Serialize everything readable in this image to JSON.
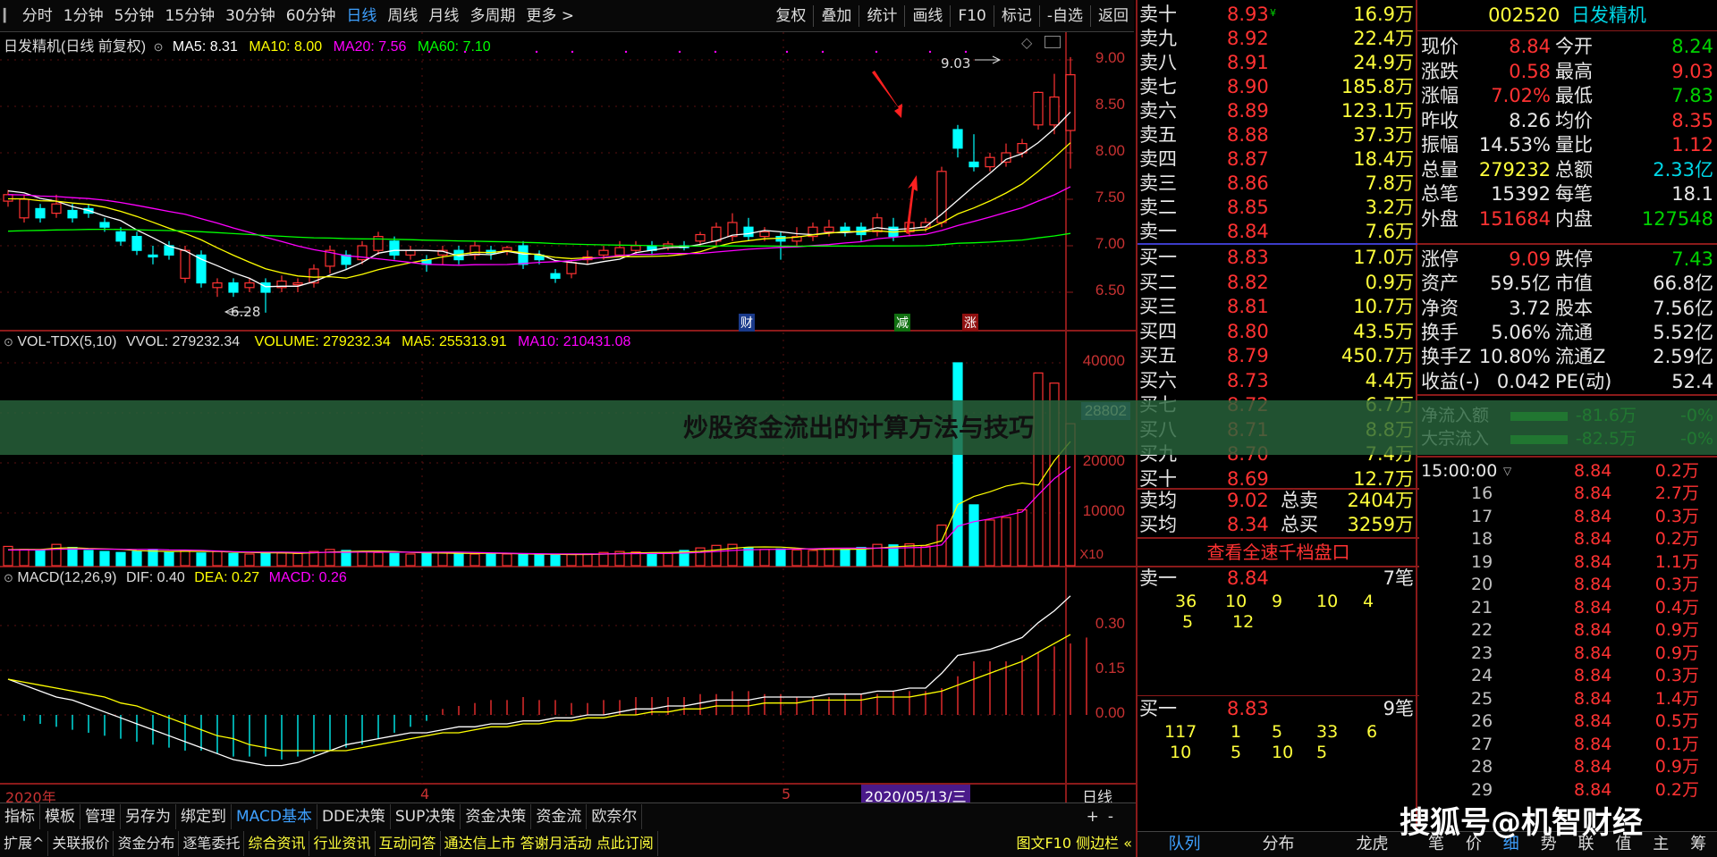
{
  "toolbar": {
    "periods": [
      "分时",
      "1分钟",
      "5分钟",
      "15分钟",
      "30分钟",
      "60分钟",
      "日线",
      "周线",
      "月线",
      "多周期",
      "更多 >"
    ],
    "actions": [
      "复权",
      "叠加",
      "统计",
      "画线",
      "F10",
      "标记",
      "-自选",
      "返回"
    ]
  },
  "kline": {
    "title": "日发精机(日线 前复权)",
    "ma5": "MA5: 8.31",
    "ma10": "MA10: 8.00",
    "ma20": "MA20: 7.56",
    "ma60": "MA60: 7.10",
    "high_label": "9.03",
    "low_label": "6.28",
    "markers": [
      "财",
      "减",
      "涨"
    ],
    "price_axis": [
      "9.00",
      "8.50",
      "8.00",
      "7.50",
      "7.00",
      "6.50"
    ],
    "colors": {
      "up": "#ff3232",
      "down": "#00ffff",
      "ma5": "#ffffff",
      "ma10": "#ffff00",
      "ma20": "#ff00ff",
      "ma60": "#00ff00"
    }
  },
  "volume": {
    "title": "VOL-TDX(5,10)",
    "vvol": "VVOL: 279232.34",
    "volume": "VOLUME: 279232.34",
    "ma5": "MA5: 255313.91",
    "ma10": "MA10: 210431.08",
    "axis": [
      "40000",
      "30000",
      "20000",
      "10000"
    ],
    "crosshair_value": "28802",
    "unit": "X10"
  },
  "macd": {
    "title": "MACD(12,26,9)",
    "dif": "DIF: 0.40",
    "dea": "DEA: 0.27",
    "macd": "MACD: 0.26",
    "axis": [
      "0.30",
      "0.15",
      "0.00"
    ]
  },
  "time_axis": {
    "labels": [
      "2020年",
      "4",
      "5"
    ],
    "date_box": "2020/05/13/三",
    "period": "日线"
  },
  "bottom_tabs": [
    "指标",
    "模板",
    "管理",
    "另存为",
    "绑定到",
    "MACD基本",
    "DDE决策",
    "SUP决策",
    "资金决策",
    "资金流",
    "欧奈尔"
  ],
  "bottom_tabs_active": "MACD基本",
  "bottom_bar2": [
    "扩展^",
    "关联报价",
    "资金分布",
    "逐笔委托",
    "综合资讯",
    "行业资讯",
    "互动问答",
    "通达信上市 答谢月活动 点此订阅"
  ],
  "bottom_bar2_right": "图文F10 侧边栏 «",
  "zoom_buttons": [
    "+",
    "-"
  ],
  "order_book": {
    "sells": [
      {
        "label": "卖十",
        "price": "8.93",
        "vol": "16.9万"
      },
      {
        "label": "卖九",
        "price": "8.92",
        "vol": "22.4万"
      },
      {
        "label": "卖八",
        "price": "8.91",
        "vol": "24.9万"
      },
      {
        "label": "卖七",
        "price": "8.90",
        "vol": "185.8万"
      },
      {
        "label": "卖六",
        "price": "8.89",
        "vol": "123.1万"
      },
      {
        "label": "卖五",
        "price": "8.88",
        "vol": "37.3万"
      },
      {
        "label": "卖四",
        "price": "8.87",
        "vol": "18.4万"
      },
      {
        "label": "卖三",
        "price": "8.86",
        "vol": "7.8万"
      },
      {
        "label": "卖二",
        "price": "8.85",
        "vol": "3.2万"
      },
      {
        "label": "卖一",
        "price": "8.84",
        "vol": "7.6万"
      }
    ],
    "buys": [
      {
        "label": "买一",
        "price": "8.83",
        "vol": "17.0万"
      },
      {
        "label": "买二",
        "price": "8.82",
        "vol": "0.9万"
      },
      {
        "label": "买三",
        "price": "8.81",
        "vol": "10.7万"
      },
      {
        "label": "买四",
        "price": "8.80",
        "vol": "43.5万"
      },
      {
        "label": "买五",
        "price": "8.79",
        "vol": "450.7万"
      },
      {
        "label": "买六",
        "price": "8.73",
        "vol": "4.4万"
      },
      {
        "label": "买七",
        "price": "8.72",
        "vol": "6.7万"
      },
      {
        "label": "买八",
        "price": "8.71",
        "vol": "8.8万"
      },
      {
        "label": "买九",
        "price": "8.70",
        "vol": "7.4万"
      },
      {
        "label": "买十",
        "price": "8.69",
        "vol": "12.7万"
      }
    ],
    "sell_ten_flag": "¥",
    "avg_sell": {
      "label": "卖均",
      "price": "9.02",
      "tlabel": "总卖",
      "val": "2404万"
    },
    "avg_buy": {
      "label": "买均",
      "price": "8.34",
      "tlabel": "总买",
      "val": "3259万"
    },
    "view_button": "查看全速千档盘口",
    "queue_sell": {
      "label": "卖一",
      "price": "8.84",
      "count": "7笔",
      "row1": [
        "36",
        "10",
        "9",
        "10",
        "4"
      ],
      "row2": [
        "5",
        "12"
      ]
    },
    "queue_buy": {
      "label": "买一",
      "price": "8.83",
      "count": "9笔",
      "row1": [
        "117",
        "1",
        "5",
        "33",
        "6"
      ],
      "row2": [
        "10",
        "5",
        "10",
        "5"
      ]
    },
    "bottom_tabs": [
      "队列",
      "分布",
      "龙虎"
    ]
  },
  "info": {
    "code": "002520",
    "name": "日发精机",
    "rows": [
      {
        "l1": "现价",
        "v1": "8.84",
        "c1": "red",
        "l2": "今开",
        "v2": "8.24",
        "c2": "green"
      },
      {
        "l1": "涨跌",
        "v1": "0.58",
        "c1": "red",
        "l2": "最高",
        "v2": "9.03",
        "c2": "red"
      },
      {
        "l1": "涨幅",
        "v1": "7.02%",
        "c1": "red",
        "l2": "最低",
        "v2": "7.83",
        "c2": "green"
      },
      {
        "l1": "昨收",
        "v1": "8.26",
        "c1": "white",
        "l2": "均价",
        "v2": "8.35",
        "c2": "red"
      },
      {
        "l1": "振幅",
        "v1": "14.53%",
        "c1": "white",
        "l2": "量比",
        "v2": "1.12",
        "c2": "red"
      },
      {
        "l1": "总量",
        "v1": "279232",
        "c1": "yellow",
        "l2": "总额",
        "v2": "2.33亿",
        "c2": "cyan"
      },
      {
        "l1": "总笔",
        "v1": "15392",
        "c1": "white",
        "l2": "每笔",
        "v2": "18.1",
        "c2": "white"
      },
      {
        "l1": "外盘",
        "v1": "151684",
        "c1": "red",
        "l2": "内盘",
        "v2": "127548",
        "c2": "green"
      }
    ],
    "rows2": [
      {
        "l1": "涨停",
        "v1": "9.09",
        "c1": "red",
        "l2": "跌停",
        "v2": "7.43",
        "c2": "green"
      },
      {
        "l1": "资产",
        "v1": "59.5亿",
        "c1": "white",
        "l2": "市值",
        "v2": "66.8亿",
        "c2": "white"
      },
      {
        "l1": "净资",
        "v1": "3.72",
        "c1": "white",
        "l2": "股本",
        "v2": "7.56亿",
        "c2": "white"
      },
      {
        "l1": "换手",
        "v1": "5.06%",
        "c1": "white",
        "l2": "流通",
        "v2": "5.52亿",
        "c2": "white"
      },
      {
        "l1": "换手Z",
        "v1": "10.80%",
        "c1": "white",
        "l2": "流通Z",
        "v2": "2.59亿",
        "c2": "white"
      },
      {
        "l1": "收益(-)",
        "v1": "0.042",
        "c1": "white",
        "l2": "PE(动)",
        "v2": "52.4",
        "c2": "white"
      }
    ],
    "flow": [
      {
        "label": "净流入额",
        "val": "-81.6万",
        "pct": "-0%"
      },
      {
        "label": "大宗流入",
        "val": "-82.5万",
        "pct": "-0%"
      }
    ],
    "tick_header_time": "15:00:00",
    "ticks": [
      {
        "t": "16",
        "p": "8.84",
        "v": "2.7万"
      },
      {
        "t": "17",
        "p": "8.84",
        "v": "0.3万"
      },
      {
        "t": "18",
        "p": "8.84",
        "v": "0.2万"
      },
      {
        "t": "19",
        "p": "8.84",
        "v": "1.1万"
      },
      {
        "t": "20",
        "p": "8.84",
        "v": "0.3万"
      },
      {
        "t": "21",
        "p": "8.84",
        "v": "0.4万"
      },
      {
        "t": "22",
        "p": "8.84",
        "v": "0.9万"
      },
      {
        "t": "23",
        "p": "8.84",
        "v": "0.9万"
      },
      {
        "t": "24",
        "p": "8.84",
        "v": "0.3万"
      },
      {
        "t": "25",
        "p": "8.84",
        "v": "1.4万"
      },
      {
        "t": "26",
        "p": "8.84",
        "v": "0.5万"
      },
      {
        "t": "27",
        "p": "8.84",
        "v": "0.1万"
      },
      {
        "t": "28",
        "p": "8.84",
        "v": "0.9万"
      },
      {
        "t": "29",
        "p": "8.84",
        "v": "0.2万"
      }
    ],
    "tick_first": {
      "p": "8.84",
      "v": "0.2万"
    },
    "bottom_tabs": [
      "笔",
      "价",
      "细",
      "势",
      "联",
      "值",
      "主",
      "筹"
    ]
  },
  "overlay": {
    "title": "炒股资金流出的计算方法与技巧"
  },
  "watermark": "搜狐号@机智财经"
}
